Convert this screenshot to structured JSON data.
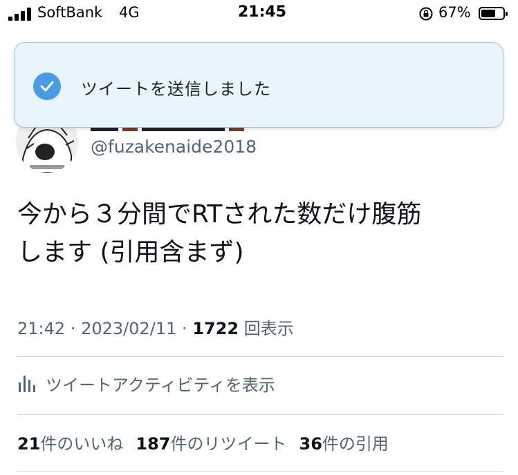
{
  "status_bar": {
    "carrier": "SoftBank",
    "network": "4G",
    "time": "21:45",
    "battery_percent": "67%",
    "battery_level": 0.67
  },
  "toast": {
    "message": "ツイートを送信しました",
    "icon": "check-circle-icon",
    "background_color": "#e8f5fd",
    "icon_color": "#4a9be5"
  },
  "tweet": {
    "handle": "@fuzakenaide2018",
    "text_line1": "今から３分間でRTされた数だけ腹筋",
    "text_line2": "します (引用含まず)",
    "time": "21:42",
    "date": "2023/02/11",
    "views_count": "1722",
    "views_label": "回表示",
    "activity_label": "ツイートアクティビティを表示",
    "likes_count": "21",
    "likes_label": "件のいいね",
    "retweets_count": "187",
    "retweets_label": "件のリツイート",
    "quotes_count": "36",
    "quotes_label": "件の引用"
  }
}
